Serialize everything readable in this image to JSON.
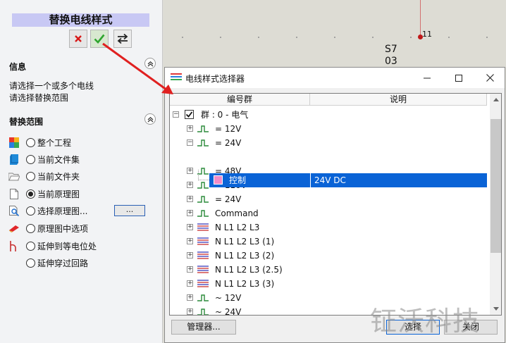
{
  "panel": {
    "title": "替换电线样式",
    "info_header": "信息",
    "info_lines": [
      "请选择一个或多个电线",
      "请选择替换范围"
    ],
    "scope_header": "替换范围",
    "scope_options": [
      {
        "label": "整个工程",
        "icon": "project-icon",
        "checked": false
      },
      {
        "label": "当前文件集",
        "icon": "fileset-icon",
        "checked": false
      },
      {
        "label": "当前文件夹",
        "icon": "folder-icon",
        "checked": false
      },
      {
        "label": "当前原理图",
        "icon": "document-icon",
        "checked": true
      },
      {
        "label": "选择原理图...",
        "icon": "search-document-icon",
        "checked": false
      },
      {
        "label": "原理图中选项",
        "icon": "eraser-icon",
        "checked": false
      },
      {
        "label": "延伸到等电位处",
        "icon": "potential-icon",
        "checked": false
      },
      {
        "label": "延伸穿过回路",
        "icon": "",
        "checked": false
      }
    ],
    "browse_label": "..."
  },
  "canvas": {
    "node_label": "11",
    "device_lines": [
      "S7",
      "03"
    ]
  },
  "dialog": {
    "title": "电线样式选择器",
    "columns": [
      "编号群",
      "说明"
    ],
    "rows": [
      {
        "label": "群 : 0 - 电气",
        "expander": "−",
        "checkbox": true,
        "icon": "",
        "level": 0
      },
      {
        "label": "=  12V",
        "expander": "+",
        "icon": "green-wire-icon",
        "level": 1
      },
      {
        "label": "=  24V",
        "expander": "−",
        "icon": "green-wire-icon",
        "level": 1
      },
      {
        "label": "=  48V",
        "expander": "+",
        "icon": "green-wire-icon",
        "level": 1
      },
      {
        "label": "= 110V",
        "expander": "+",
        "icon": "green-wire-icon",
        "level": 1
      },
      {
        "label": "= 24V",
        "expander": "+",
        "icon": "green-wire-icon",
        "level": 1
      },
      {
        "label": "Command",
        "expander": "+",
        "icon": "green-wire-icon",
        "level": 1
      },
      {
        "label": "N L1 L2 L3",
        "expander": "+",
        "icon": "multi-wire-icon",
        "level": 1
      },
      {
        "label": "N L1 L2 L3 (1)",
        "expander": "+",
        "icon": "multi-wire-icon",
        "level": 1
      },
      {
        "label": "N L1 L2 L3 (2)",
        "expander": "+",
        "icon": "multi-wire-icon",
        "level": 1
      },
      {
        "label": "N L1 L2 L3 (2.5)",
        "expander": "+",
        "icon": "multi-wire-icon",
        "level": 1
      },
      {
        "label": "N L1 L2 L3 (3)",
        "expander": "+",
        "icon": "multi-wire-icon",
        "level": 1
      },
      {
        "label": "~  12V",
        "expander": "+",
        "icon": "green-wire-icon",
        "level": 1
      },
      {
        "label": "~  24V",
        "expander": "+",
        "icon": "green-wire-icon",
        "level": 1
      }
    ],
    "selected": {
      "label": "控制",
      "description": "24V DC",
      "swatch_color": "#f08cc8"
    },
    "buttons": {
      "manager": "管理器...",
      "select": "选择",
      "close": "关闭"
    }
  },
  "watermark": "钲沃科技",
  "colors": {
    "selection": "#0a63d6",
    "title_band": "#c8c8f4",
    "arrow": "#e02020",
    "wire_green": "#2a8a3a"
  }
}
